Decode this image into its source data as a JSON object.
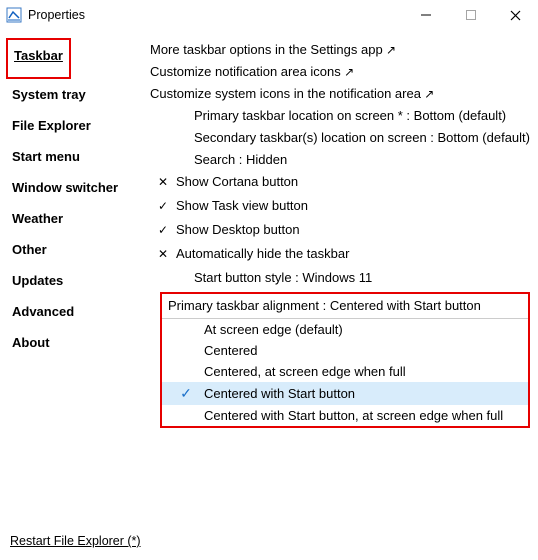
{
  "window": {
    "title": "Properties"
  },
  "sidebar": {
    "items": [
      {
        "label": "Taskbar",
        "active": true
      },
      {
        "label": "System tray"
      },
      {
        "label": "File Explorer"
      },
      {
        "label": "Start menu"
      },
      {
        "label": "Window switcher"
      },
      {
        "label": "Weather"
      },
      {
        "label": "Other"
      },
      {
        "label": "Updates"
      },
      {
        "label": "Advanced"
      },
      {
        "label": "About"
      }
    ]
  },
  "main": {
    "link_more_options": "More taskbar options in the Settings app",
    "link_notif_icons": "Customize notification area icons",
    "link_sys_icons": "Customize system icons in the notification area",
    "primary_location": "Primary taskbar location on screen * : Bottom (default)",
    "secondary_location": "Secondary taskbar(s) location on screen : Bottom (default)",
    "search": "Search : Hidden",
    "cortana": "Show Cortana button",
    "taskview": "Show Task view button",
    "desktop": "Show Desktop button",
    "autohide": "Automatically hide the taskbar",
    "start_style": "Start button style : Windows 11"
  },
  "dropdown": {
    "header": "Primary taskbar alignment : Centered with Start button",
    "opts": [
      "At screen edge (default)",
      "Centered",
      "Centered, at screen edge when full",
      "Centered with Start button",
      "Centered with Start button, at screen edge when full"
    ],
    "selected_index": 3
  },
  "footer": {
    "restart": "Restart File Explorer (*)"
  },
  "glyphs": {
    "check": "✓",
    "cross": "✕"
  }
}
